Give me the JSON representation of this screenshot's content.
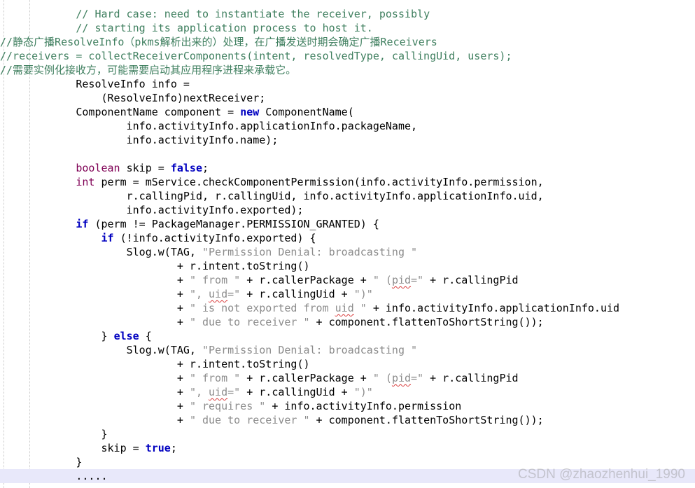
{
  "editor": {
    "lines": [
      {
        "indent": 12,
        "tokens": [
          [
            "cm",
            "// Hard case: need to instantiate the receiver, possibly"
          ]
        ]
      },
      {
        "indent": 12,
        "tokens": [
          [
            "cm",
            "// starting its application process to host it."
          ]
        ]
      },
      {
        "indent": 0,
        "tokens": [
          [
            "cm",
            "//静态广播ResolveInfo（pkms解析出来的）处理，在广播发送时期会确定广播Receivers"
          ]
        ]
      },
      {
        "indent": 0,
        "tokens": [
          [
            "cm",
            "//receivers = collectReceiverComponents(intent, resolvedType, callingUid, users);"
          ]
        ]
      },
      {
        "indent": 0,
        "tokens": [
          [
            "cm",
            "//需要实例化接收方，可能需要启动其应用程序进程来承载它。"
          ]
        ]
      },
      {
        "indent": 12,
        "tokens": [
          [
            "tx",
            "ResolveInfo info ="
          ]
        ]
      },
      {
        "indent": 16,
        "tokens": [
          [
            "tx",
            "(ResolveInfo)nextReceiver;"
          ]
        ]
      },
      {
        "indent": 12,
        "tokens": [
          [
            "tx",
            "ComponentName component = "
          ],
          [
            "kw",
            "new"
          ],
          [
            "tx",
            " ComponentName("
          ]
        ]
      },
      {
        "indent": 20,
        "tokens": [
          [
            "tx",
            "info.activityInfo.applicationInfo.packageName,"
          ]
        ]
      },
      {
        "indent": 20,
        "tokens": [
          [
            "tx",
            "info.activityInfo.name);"
          ]
        ]
      },
      {
        "indent": 0,
        "tokens": []
      },
      {
        "indent": 12,
        "tokens": [
          [
            "ty",
            "boolean"
          ],
          [
            "tx",
            " skip = "
          ],
          [
            "kw",
            "false"
          ],
          [
            "tx",
            ";"
          ]
        ]
      },
      {
        "indent": 12,
        "tokens": [
          [
            "ty",
            "int"
          ],
          [
            "tx",
            " perm = mService.checkComponentPermission(info.activityInfo.permission,"
          ]
        ]
      },
      {
        "indent": 20,
        "tokens": [
          [
            "tx",
            "r.callingPid, r.callingUid, info.activityInfo.applicationInfo.uid,"
          ]
        ]
      },
      {
        "indent": 20,
        "tokens": [
          [
            "tx",
            "info.activityInfo.exported);"
          ]
        ]
      },
      {
        "indent": 12,
        "tokens": [
          [
            "kw",
            "if"
          ],
          [
            "tx",
            " (perm != PackageManager.PERMISSION_GRANTED) {"
          ]
        ]
      },
      {
        "indent": 16,
        "tokens": [
          [
            "kw",
            "if"
          ],
          [
            "tx",
            " (!info.activityInfo.exported) {"
          ]
        ]
      },
      {
        "indent": 20,
        "tokens": [
          [
            "tx",
            "Slog.w(TAG, "
          ],
          [
            "str",
            "\"Permission Denial: broadcasting \""
          ]
        ]
      },
      {
        "indent": 28,
        "tokens": [
          [
            "tx",
            "+ r.intent.toString()"
          ]
        ]
      },
      {
        "indent": 28,
        "tokens": [
          [
            "tx",
            "+ "
          ],
          [
            "str",
            "\" from \""
          ],
          [
            "tx",
            " + r.callerPackage + "
          ],
          [
            "str",
            "\" ("
          ],
          [
            "sq",
            "pid"
          ],
          [
            "str",
            "=\""
          ],
          [
            "tx",
            " + r.callingPid"
          ]
        ]
      },
      {
        "indent": 28,
        "tokens": [
          [
            "tx",
            "+ "
          ],
          [
            "str",
            "\", "
          ],
          [
            "sq",
            "uid"
          ],
          [
            "str",
            "=\""
          ],
          [
            "tx",
            " + r.callingUid + "
          ],
          [
            "str",
            "\")\""
          ]
        ]
      },
      {
        "indent": 28,
        "tokens": [
          [
            "tx",
            "+ "
          ],
          [
            "str",
            "\" is not exported from "
          ],
          [
            "sq",
            "uid"
          ],
          [
            "str",
            " \""
          ],
          [
            "tx",
            " + info.activityInfo.applicationInfo.uid"
          ]
        ]
      },
      {
        "indent": 28,
        "tokens": [
          [
            "tx",
            "+ "
          ],
          [
            "str",
            "\" due to receiver \""
          ],
          [
            "tx",
            " + component.flattenToShortString());"
          ]
        ]
      },
      {
        "indent": 16,
        "tokens": [
          [
            "tx",
            "} "
          ],
          [
            "kw",
            "else"
          ],
          [
            "tx",
            " {"
          ]
        ]
      },
      {
        "indent": 20,
        "tokens": [
          [
            "tx",
            "Slog.w(TAG, "
          ],
          [
            "str",
            "\"Permission Denial: broadcasting \""
          ]
        ]
      },
      {
        "indent": 28,
        "tokens": [
          [
            "tx",
            "+ r.intent.toString()"
          ]
        ]
      },
      {
        "indent": 28,
        "tokens": [
          [
            "tx",
            "+ "
          ],
          [
            "str",
            "\" from \""
          ],
          [
            "tx",
            " + r.callerPackage + "
          ],
          [
            "str",
            "\" ("
          ],
          [
            "sq",
            "pid"
          ],
          [
            "str",
            "=\""
          ],
          [
            "tx",
            " + r.callingPid"
          ]
        ]
      },
      {
        "indent": 28,
        "tokens": [
          [
            "tx",
            "+ "
          ],
          [
            "str",
            "\", "
          ],
          [
            "sq",
            "uid"
          ],
          [
            "str",
            "=\""
          ],
          [
            "tx",
            " + r.callingUid + "
          ],
          [
            "str",
            "\")\""
          ]
        ]
      },
      {
        "indent": 28,
        "tokens": [
          [
            "tx",
            "+ "
          ],
          [
            "str",
            "\" requires \""
          ],
          [
            "tx",
            " + info.activityInfo.permission"
          ]
        ]
      },
      {
        "indent": 28,
        "tokens": [
          [
            "tx",
            "+ "
          ],
          [
            "str",
            "\" due to receiver \""
          ],
          [
            "tx",
            " + component.flattenToShortString());"
          ]
        ]
      },
      {
        "indent": 16,
        "tokens": [
          [
            "tx",
            "}"
          ]
        ]
      },
      {
        "indent": 16,
        "tokens": [
          [
            "tx",
            "skip = "
          ],
          [
            "kw",
            "true"
          ],
          [
            "tx",
            ";"
          ]
        ]
      },
      {
        "indent": 12,
        "tokens": [
          [
            "tx",
            "}"
          ]
        ]
      },
      {
        "indent": 12,
        "tokens": [
          [
            "tx",
            "....."
          ]
        ],
        "current": true
      }
    ]
  },
  "watermark": "CSDN @zhaozhenhui_1990",
  "colors": {
    "comment": "#3f7f5f",
    "keyword": "#0000c0",
    "type": "#7f0055",
    "string": "#8c8c8c",
    "text": "#000000",
    "current_line": "#e8e8fa"
  }
}
